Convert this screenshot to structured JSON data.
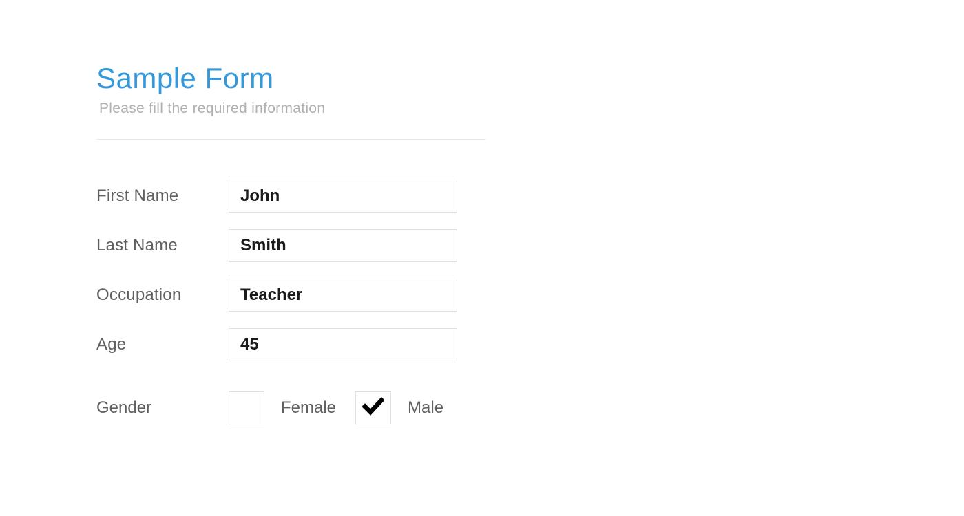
{
  "header": {
    "title": "Sample Form",
    "subtitle": "Please fill the required information"
  },
  "fields": {
    "firstName": {
      "label": "First Name",
      "value": "John"
    },
    "lastName": {
      "label": "Last Name",
      "value": "Smith"
    },
    "occupation": {
      "label": "Occupation",
      "value": "Teacher"
    },
    "age": {
      "label": "Age",
      "value": "45"
    }
  },
  "gender": {
    "label": "Gender",
    "options": {
      "female": {
        "label": "Female",
        "checked": false
      },
      "male": {
        "label": "Male",
        "checked": true
      }
    }
  }
}
